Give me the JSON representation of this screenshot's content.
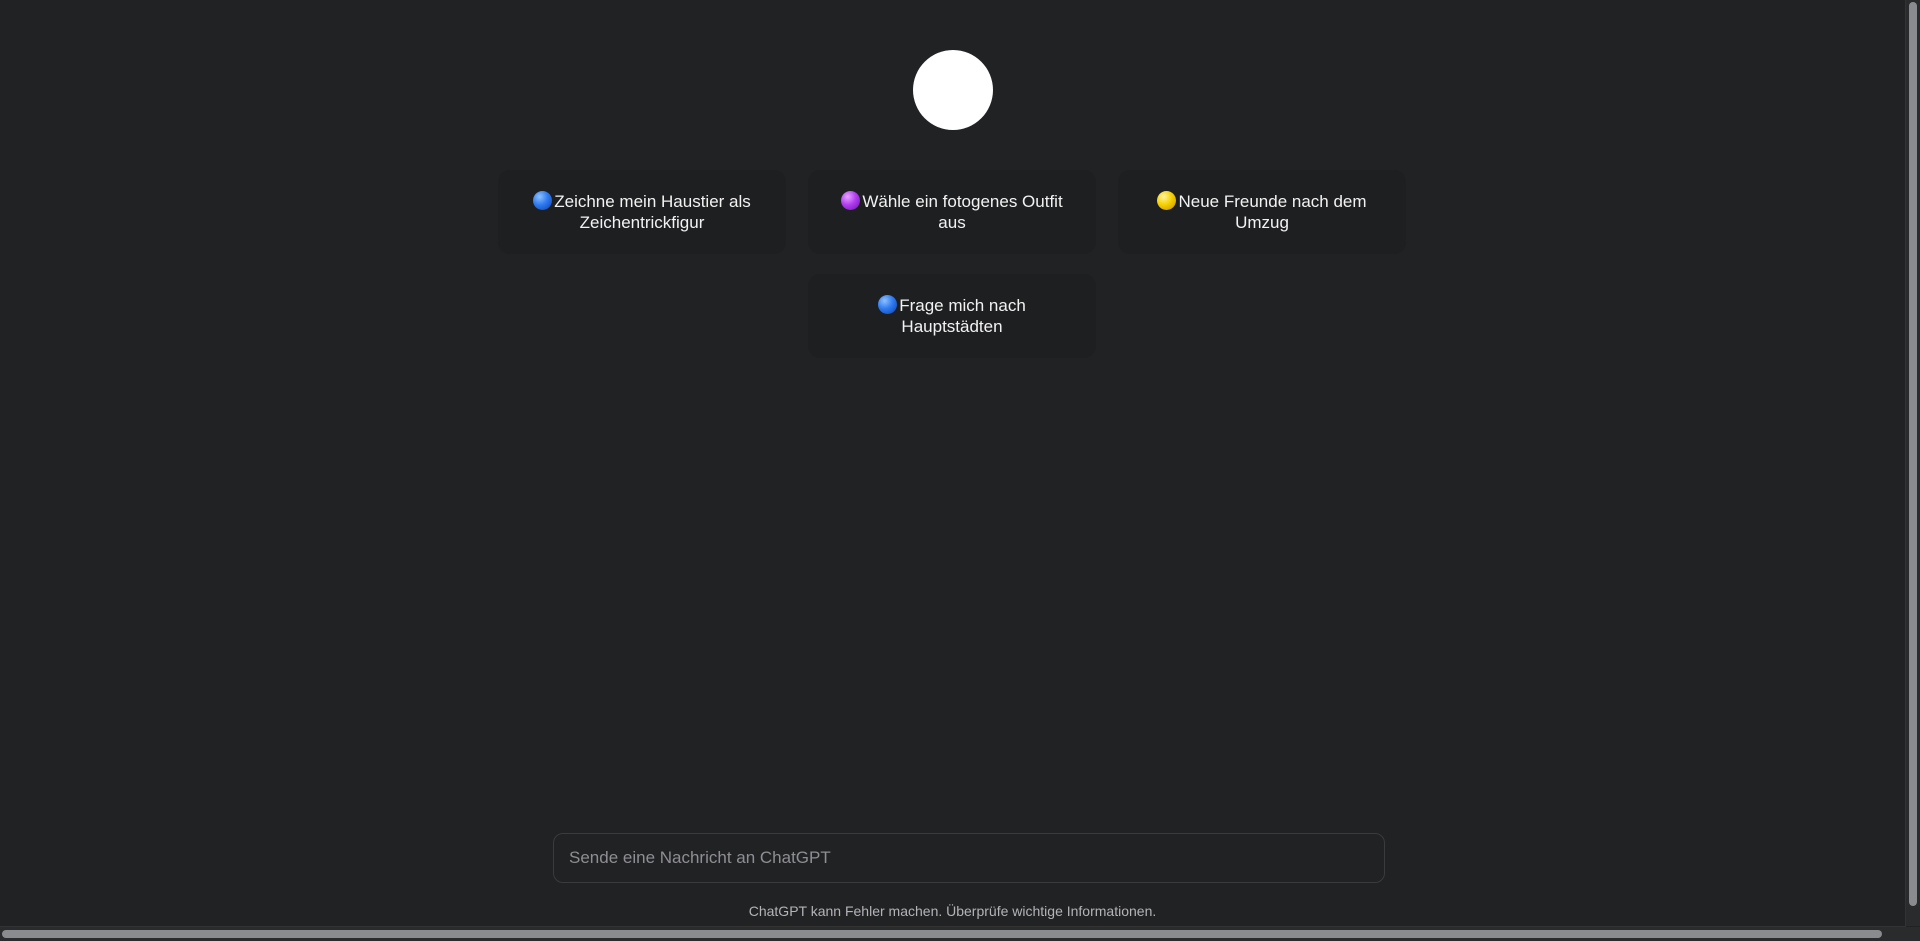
{
  "suggestions": [
    {
      "icon": "blue-circle-icon",
      "color": "#2f7bf0",
      "label": "Zeichne mein Haustier als Zeichentrickfigur"
    },
    {
      "icon": "purple-circle-icon",
      "color": "#b23ef0",
      "label": "Wähle ein fotogenes Outfit aus"
    },
    {
      "icon": "yellow-circle-icon",
      "color": "#f5d000",
      "label": "Neue Freunde nach dem Umzug"
    },
    {
      "icon": "blue-circle-icon",
      "color": "#2f7bf0",
      "label": "Frage mich nach Hauptstädten"
    }
  ],
  "composer": {
    "placeholder": "Sende eine Nachricht an ChatGPT",
    "value": ""
  },
  "footer": {
    "disclaimer": "ChatGPT kann Fehler machen. Überprüfe wichtige Informationen."
  },
  "theme": {
    "background": "#212224",
    "card_background": "#1e1f21"
  }
}
